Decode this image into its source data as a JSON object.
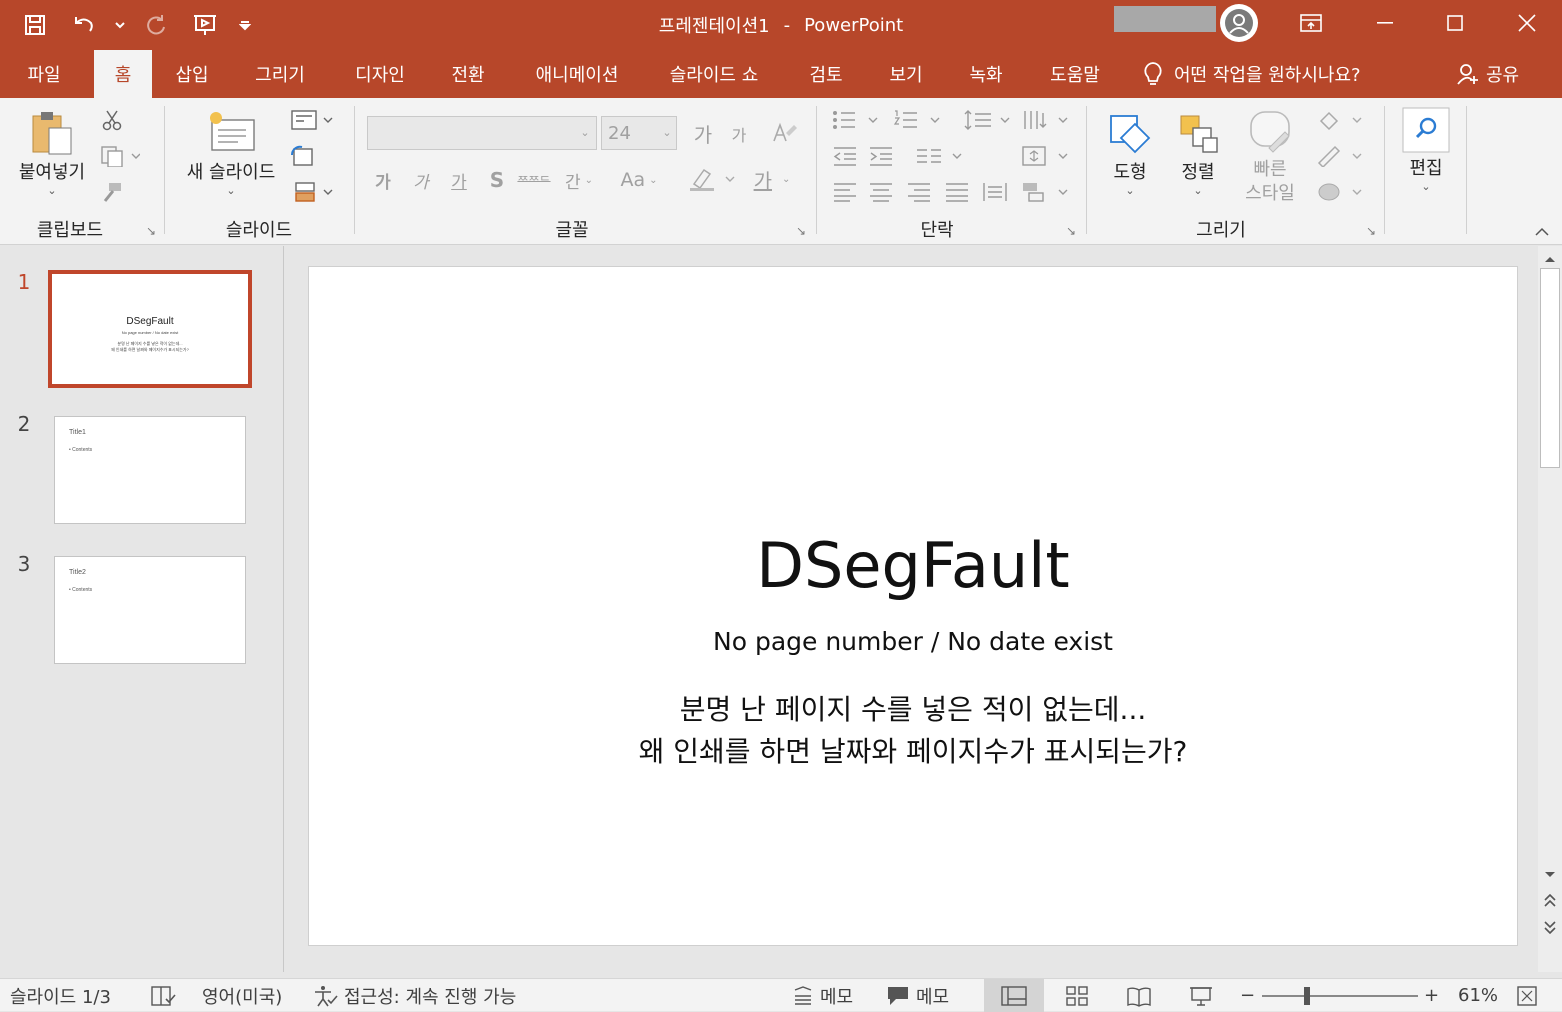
{
  "app": {
    "title": "프레젠테이션1",
    "separator": "-",
    "name": "PowerPoint"
  },
  "tabs": [
    {
      "label": "파일"
    },
    {
      "label": "홈"
    },
    {
      "label": "삽입"
    },
    {
      "label": "그리기"
    },
    {
      "label": "디자인"
    },
    {
      "label": "전환"
    },
    {
      "label": "애니메이션"
    },
    {
      "label": "슬라이드 쇼"
    },
    {
      "label": "검토"
    },
    {
      "label": "보기"
    },
    {
      "label": "녹화"
    },
    {
      "label": "도움말"
    }
  ],
  "active_tab": "홈",
  "tell_me": "어떤 작업을 원하시나요?",
  "share_label": "공유",
  "ribbon": {
    "clipboard": {
      "paste_label": "붙여넣기",
      "group_label": "클립보드"
    },
    "slides": {
      "new_slide_label": "새 슬라이드",
      "group_label": "슬라이드"
    },
    "font": {
      "font_name": "",
      "font_size": "24",
      "group_label": "글꼴",
      "grow": "가",
      "shrink": "가",
      "bold": "가",
      "italic": "가",
      "underline": "가",
      "shadow": "S",
      "strike": "ᄍᄍᄃ",
      "spacing": "간",
      "case": "Aa",
      "color": "가"
    },
    "paragraph": {
      "group_label": "단락"
    },
    "drawing": {
      "shape_label": "도형",
      "arrange_label": "정렬",
      "quick_style_line1": "빠른",
      "quick_style_line2": "스타일",
      "group_label": "그리기"
    },
    "editing": {
      "label": "편집"
    }
  },
  "slides": [
    {
      "number": "1",
      "title": "DSegFault",
      "subtitle": "No page number / No date exist",
      "body_line1": "분명 난 페이지 수를 넣은 적이 없는데...",
      "body_line2": "왜 인쇄를 하면 날짜와 페이지수가 표시되는가?"
    },
    {
      "number": "2",
      "title": "Title1",
      "content": "• Contents"
    },
    {
      "number": "3",
      "title": "Title2",
      "content": "• Contents"
    }
  ],
  "selected_slide": 1,
  "status": {
    "slide_counter": "슬라이드 1/3",
    "language": "영어(미국)",
    "accessibility": "접근성: 계속 진행 가능",
    "notes_label": "메모",
    "comments_label": "메모",
    "zoom_minus": "−",
    "zoom_plus": "+",
    "zoom": "61%",
    "zoom_level": 0.61
  },
  "colors": {
    "accent": "#b7472a",
    "selected_border": "#c0462b"
  }
}
